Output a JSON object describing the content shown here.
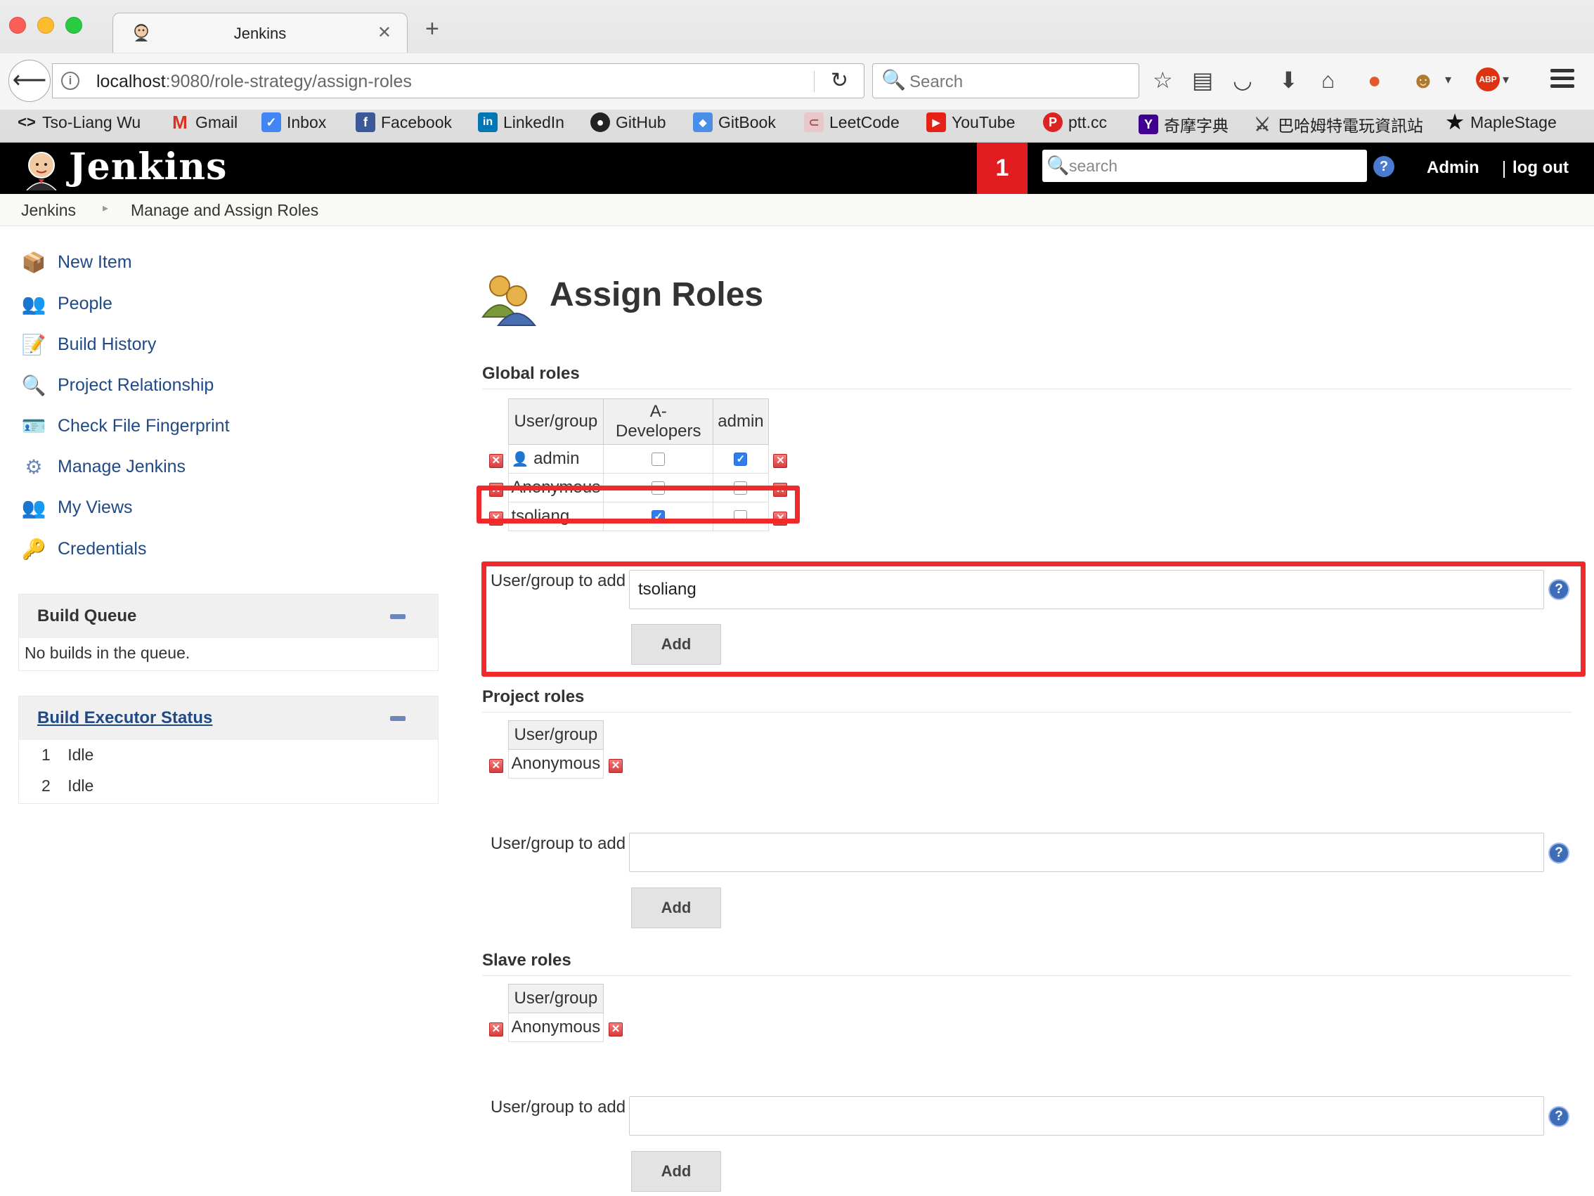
{
  "browser": {
    "tab_title": "Jenkins",
    "url_host": "localhost",
    "url_path": ":9080/role-strategy/assign-roles",
    "search_placeholder": "Search",
    "bookmarks": [
      {
        "label": "Tso-Liang Wu",
        "icon": "code-icon"
      },
      {
        "label": "Gmail",
        "icon": "gmail-icon"
      },
      {
        "label": "Inbox",
        "icon": "inbox-icon"
      },
      {
        "label": "Facebook",
        "icon": "facebook-icon"
      },
      {
        "label": "LinkedIn",
        "icon": "linkedin-icon"
      },
      {
        "label": "GitHub",
        "icon": "github-icon"
      },
      {
        "label": "GitBook",
        "icon": "gitbook-icon"
      },
      {
        "label": "LeetCode",
        "icon": "leetcode-icon"
      },
      {
        "label": "YouTube",
        "icon": "youtube-icon"
      },
      {
        "label": "ptt.cc",
        "icon": "ptt-icon"
      },
      {
        "label": "奇摩字典",
        "icon": "yahoo-icon"
      },
      {
        "label": "巴哈姆特電玩資訊站",
        "icon": "bahamut-icon"
      },
      {
        "label": "MapleStage",
        "icon": "star-icon"
      }
    ]
  },
  "jenkins": {
    "title": "Jenkins",
    "notification_count": "1",
    "search_placeholder": "search",
    "user": "Admin",
    "logout": "log out",
    "breadcrumb": [
      "Jenkins",
      "Manage and Assign Roles"
    ]
  },
  "sidebar": {
    "items": [
      {
        "label": "New Item",
        "icon": "new-item-icon"
      },
      {
        "label": "People",
        "icon": "people-icon"
      },
      {
        "label": "Build History",
        "icon": "notepad-icon"
      },
      {
        "label": "Project Relationship",
        "icon": "magnifier-icon"
      },
      {
        "label": "Check File Fingerprint",
        "icon": "fingerprint-icon"
      },
      {
        "label": "Manage Jenkins",
        "icon": "gear-icon"
      },
      {
        "label": "My Views",
        "icon": "people-icon"
      },
      {
        "label": "Credentials",
        "icon": "key-icon"
      }
    ],
    "build_queue": {
      "title": "Build Queue",
      "empty_text": "No builds in the queue."
    },
    "executors": {
      "title": "Build Executor Status",
      "rows": [
        {
          "num": "1",
          "status": "Idle"
        },
        {
          "num": "2",
          "status": "Idle"
        }
      ]
    }
  },
  "main": {
    "title": "Assign Roles",
    "global": {
      "heading": "Global roles",
      "columns": [
        "User/group",
        "A-Developers",
        "admin"
      ],
      "rows": [
        {
          "name": "admin",
          "checks": [
            false,
            true
          ]
        },
        {
          "name": "Anonymous",
          "checks": [
            false,
            false
          ]
        },
        {
          "name": "tsoliang",
          "checks": [
            true,
            false
          ]
        }
      ],
      "add_label": "User/group to add",
      "add_value": "tsoliang",
      "add_button": "Add"
    },
    "project": {
      "heading": "Project roles",
      "column": "User/group",
      "rows": [
        "Anonymous"
      ],
      "add_label": "User/group to add",
      "add_value": "",
      "add_button": "Add"
    },
    "slave": {
      "heading": "Slave roles",
      "column": "User/group",
      "rows": [
        "Anonymous"
      ],
      "add_label": "User/group to add",
      "add_value": "",
      "add_button": "Add"
    }
  },
  "colors": {
    "jenkins_header": "#000000",
    "notification": "#e11d21",
    "highlight": "#f02a2a",
    "link": "#204a87"
  }
}
